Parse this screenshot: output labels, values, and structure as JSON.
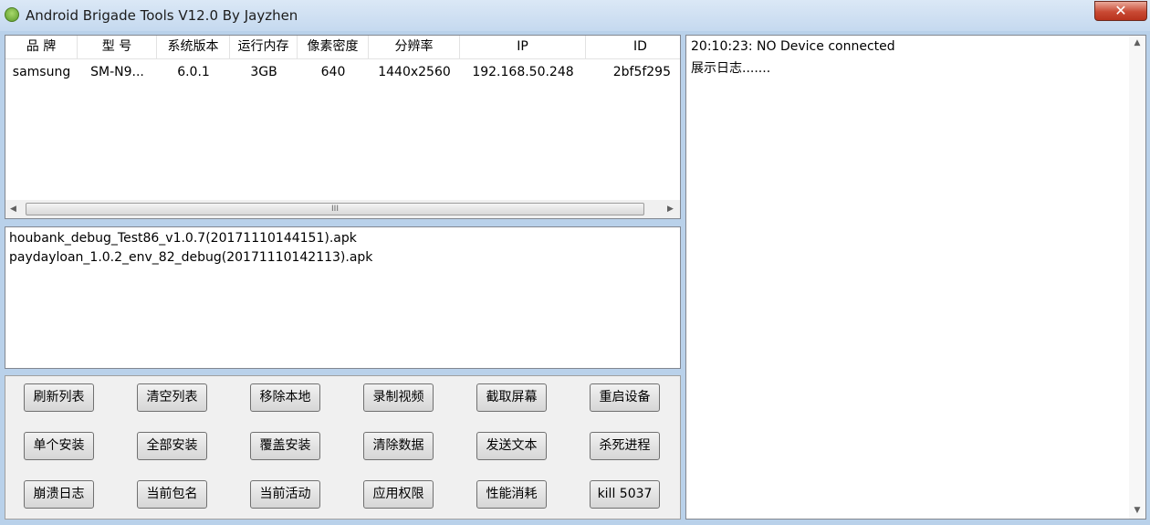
{
  "window": {
    "title": "Android Brigade Tools V12.0 By Jayzhen",
    "close_label": "✕"
  },
  "device_table": {
    "columns": [
      "品 牌",
      "型 号",
      "系统版本",
      "运行内存",
      "像素密度",
      "分辨率",
      "IP",
      "ID"
    ],
    "rows": [
      [
        "samsung",
        "SM-N9...",
        "6.0.1",
        "3GB",
        "640",
        "1440x2560",
        "192.168.50.248",
        "2bf5f295"
      ]
    ],
    "scroll_grip": "III"
  },
  "apk_list": [
    "houbank_debug_Test86_v1.0.7(20171110144151).apk",
    "paydayloan_1.0.2_env_82_debug(20171110142113).apk"
  ],
  "log": [
    "20:10:23: NO Device connected",
    "展示日志......."
  ],
  "buttons": {
    "row1": [
      "刷新列表",
      "清空列表",
      "移除本地",
      "录制视频",
      "截取屏幕",
      "重启设备"
    ],
    "row2": [
      "单个安装",
      "全部安装",
      "覆盖安装",
      "清除数据",
      "发送文本",
      "杀死进程"
    ],
    "row3": [
      "崩溃日志",
      "当前包名",
      "当前活动",
      "应用权限",
      "性能消耗",
      "kill 5037"
    ]
  },
  "icons": {
    "scroll_left": "◀",
    "scroll_right": "▶",
    "scroll_up": "▲",
    "scroll_down": "▼"
  }
}
